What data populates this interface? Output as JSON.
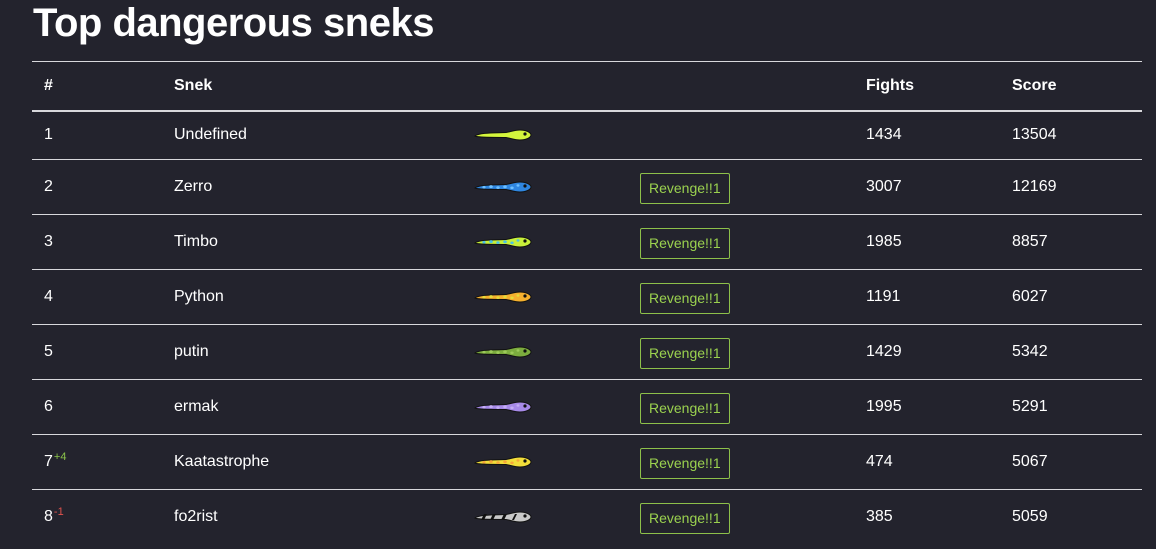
{
  "page": {
    "title": "Top dangerous sneks"
  },
  "table": {
    "headers": {
      "rank": "#",
      "snek": "Snek",
      "skin": "",
      "action": "",
      "fights": "Fights",
      "score": "Score"
    },
    "rows": [
      {
        "rank": "1",
        "change": "",
        "change_dir": "",
        "name": "Undefined",
        "skin": {
          "body": "#d4f53c",
          "spots": null,
          "pattern": "plain"
        },
        "action": "",
        "fights": "1434",
        "score": "13504"
      },
      {
        "rank": "2",
        "change": "",
        "change_dir": "",
        "name": "Zerro",
        "skin": {
          "body": "#2f86e0",
          "spots": "#6ec0ff",
          "pattern": "spots"
        },
        "action": "Revenge!!1",
        "fights": "3007",
        "score": "12169"
      },
      {
        "rank": "3",
        "change": "",
        "change_dir": "",
        "name": "Timbo",
        "skin": {
          "body": "#c8f03a",
          "spots": "#49c3e6",
          "pattern": "spots"
        },
        "action": "Revenge!!1",
        "fights": "1985",
        "score": "8857"
      },
      {
        "rank": "4",
        "change": "",
        "change_dir": "",
        "name": "Python",
        "skin": {
          "body": "#f5b02e",
          "spots": "#e5dc3a",
          "pattern": "spots"
        },
        "action": "Revenge!!1",
        "fights": "1191",
        "score": "6027"
      },
      {
        "rank": "5",
        "change": "",
        "change_dir": "",
        "name": "putin",
        "skin": {
          "body": "#7cac3e",
          "spots": "#9cc95a",
          "pattern": "spots"
        },
        "action": "Revenge!!1",
        "fights": "1429",
        "score": "5342"
      },
      {
        "rank": "6",
        "change": "",
        "change_dir": "",
        "name": "ermak",
        "skin": {
          "body": "#a78ae8",
          "spots": "#c4adf5",
          "pattern": "spots"
        },
        "action": "Revenge!!1",
        "fights": "1995",
        "score": "5291"
      },
      {
        "rank": "7",
        "change": "+4",
        "change_dir": "up",
        "name": "Kaatastrophe",
        "skin": {
          "body": "#f2de3a",
          "spots": "#f7a73a",
          "pattern": "spots"
        },
        "action": "Revenge!!1",
        "fights": "474",
        "score": "5067"
      },
      {
        "rank": "8",
        "change": "-1",
        "change_dir": "down",
        "name": "fo2rist",
        "skin": {
          "body": "#c9c9c9",
          "spots": "#111111",
          "pattern": "stripes"
        },
        "action": "Revenge!!1",
        "fights": "385",
        "score": "5059"
      }
    ]
  },
  "colors": {
    "background": "#23232d",
    "text": "#ffffff",
    "divider": "#d8d8dc",
    "accent_green": "#9bd24f",
    "rank_up": "#8bc34a",
    "rank_down": "#e0524d"
  },
  "icons": {
    "snek_skin": "snake-icon"
  }
}
